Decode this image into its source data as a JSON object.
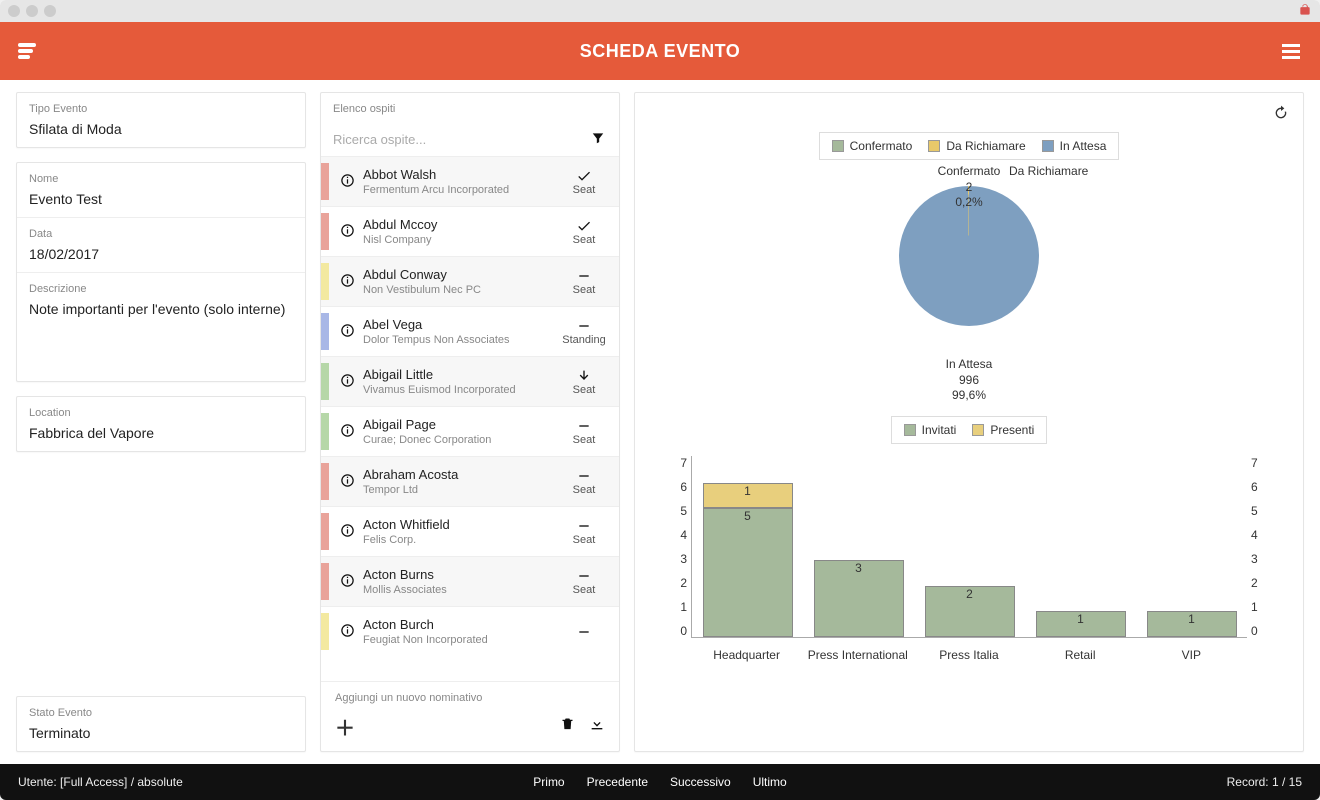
{
  "header": {
    "title": "SCHEDA EVENTO"
  },
  "event": {
    "type_label": "Tipo Evento",
    "type_value": "Sfilata di Moda",
    "name_label": "Nome",
    "name_value": "Evento Test",
    "date_label": "Data",
    "date_value": "18/02/2017",
    "desc_label": "Descrizione",
    "desc_value": "Note importanti per l'evento (solo interne)",
    "location_label": "Location",
    "location_value": "Fabbrica del Vapore",
    "status_label": "Stato Evento",
    "status_value": "Terminato"
  },
  "guestlist": {
    "title": "Elenco ospiti",
    "search_placeholder": "Ricerca ospite...",
    "add_label": "Aggiungi un nuovo nominativo",
    "guests": [
      {
        "name": "Abbot Walsh",
        "company": "Fermentum Arcu Incorporated",
        "seat": "Seat",
        "status": "check",
        "color": "#e9a39a"
      },
      {
        "name": "Abdul Mccoy",
        "company": "Nisl Company",
        "seat": "Seat",
        "status": "check",
        "color": "#e9a39a"
      },
      {
        "name": "Abdul Conway",
        "company": "Non Vestibulum Nec PC",
        "seat": "Seat",
        "status": "minus",
        "color": "#f3e9a0"
      },
      {
        "name": "Abel Vega",
        "company": "Dolor Tempus Non Associates",
        "seat": "Standing",
        "status": "minus",
        "color": "#a8b7e6"
      },
      {
        "name": "Abigail Little",
        "company": "Vivamus Euismod Incorporated",
        "seat": "Seat",
        "status": "arrow",
        "color": "#b6d7a8"
      },
      {
        "name": "Abigail Page",
        "company": "Curae; Donec Corporation",
        "seat": "Seat",
        "status": "minus",
        "color": "#b6d7a8"
      },
      {
        "name": "Abraham Acosta",
        "company": "Tempor Ltd",
        "seat": "Seat",
        "status": "minus",
        "color": "#e9a39a"
      },
      {
        "name": "Acton Whitfield",
        "company": "Felis Corp.",
        "seat": "Seat",
        "status": "minus",
        "color": "#e9a39a"
      },
      {
        "name": "Acton Burns",
        "company": "Mollis Associates",
        "seat": "Seat",
        "status": "minus",
        "color": "#e9a39a"
      },
      {
        "name": "Acton Burch",
        "company": "Feugiat Non Incorporated",
        "seat": "",
        "status": "minus",
        "color": "#f3e9a0"
      }
    ]
  },
  "chart_data": [
    {
      "type": "pie",
      "legend": [
        "Confermato",
        "Da Richiamare",
        "In Attesa"
      ],
      "colors": {
        "Confermato": "#a5b99b",
        "Da Richiamare": "#e8c96a",
        "In Attesa": "#7e9fc0"
      },
      "slices": [
        {
          "label": "Confermato",
          "value": 2,
          "percent_text": "0,2%"
        },
        {
          "label": "Da Richiamare",
          "value": 0,
          "percent_text": ""
        },
        {
          "label": "In Attesa",
          "value": 996,
          "percent_text": "99,6%"
        }
      ],
      "top_label_lines": [
        "Confermato",
        "2",
        "0,2%"
      ],
      "side_label": "Da Richiamare",
      "bottom_label_lines": [
        "In Attesa",
        "996",
        "99,6%"
      ]
    },
    {
      "type": "bar",
      "legend": [
        "Invitati",
        "Presenti"
      ],
      "categories": [
        "Headquarter",
        "Press International",
        "Press Italia",
        "Retail",
        "VIP"
      ],
      "series": [
        {
          "name": "Invitati",
          "values": [
            5,
            3,
            2,
            1,
            1
          ],
          "color": "#a5b99b"
        },
        {
          "name": "Presenti",
          "values": [
            1,
            0,
            0,
            0,
            0
          ],
          "color": "#e8cf7d"
        }
      ],
      "ylim": [
        0,
        7
      ],
      "yticks": [
        0,
        1,
        2,
        3,
        4,
        5,
        6,
        7
      ]
    }
  ],
  "footer": {
    "user": "Utente: [Full Access] / absolute",
    "nav": {
      "first": "Primo",
      "prev": "Precedente",
      "next": "Successivo",
      "last": "Ultimo"
    },
    "record": "Record: 1 / 15"
  }
}
